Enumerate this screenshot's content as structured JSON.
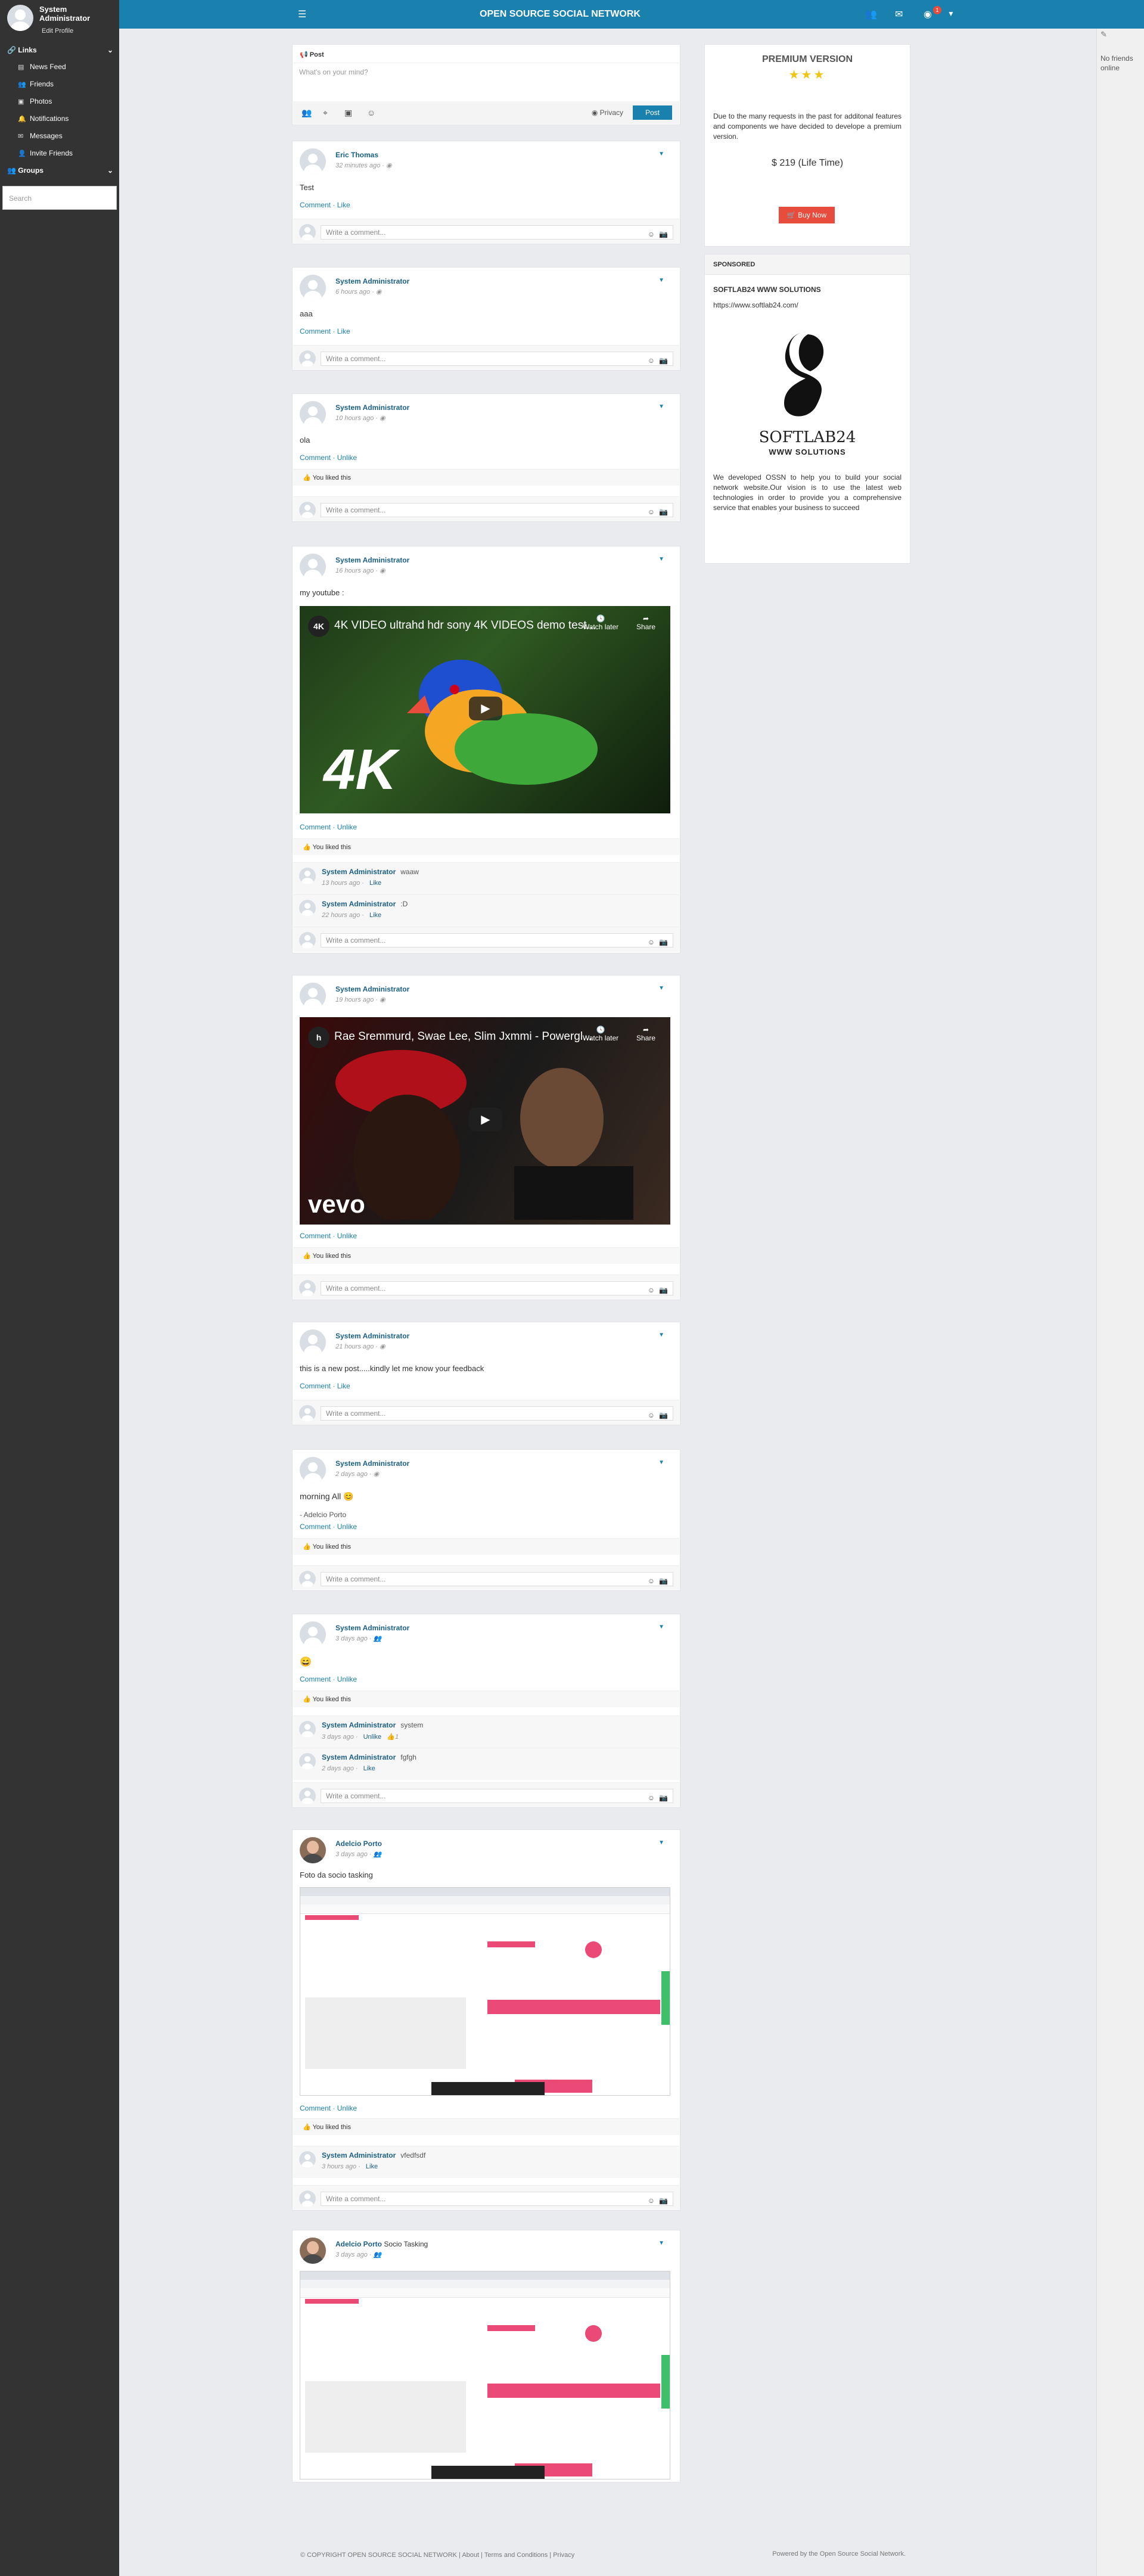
{
  "sidebar": {
    "profile_name": "System Administrator",
    "edit_profile": "Edit Profile",
    "links_label": "Links",
    "items": [
      {
        "label": "News Feed",
        "icon": "newspaper-icon"
      },
      {
        "label": "Friends",
        "icon": "users-icon"
      },
      {
        "label": "Photos",
        "icon": "image-icon"
      },
      {
        "label": "Notifications",
        "icon": "bell-icon"
      },
      {
        "label": "Messages",
        "icon": "envelope-icon"
      },
      {
        "label": "Invite Friends",
        "icon": "user-plus-icon"
      }
    ],
    "groups_label": "Groups",
    "search_placeholder": "Search"
  },
  "topbar": {
    "title": "OPEN SOURCE SOCIAL NETWORK",
    "notification_count": "1",
    "color": "#1a80ad"
  },
  "right_sidebar": {
    "status": "No friends online"
  },
  "post_composer": {
    "tab_label": "Post",
    "placeholder": "What's on your mind?",
    "privacy_label": "Privacy",
    "post_button": "Post"
  },
  "posts": [
    {
      "author": "Eric Thomas",
      "time": "32 minutes ago",
      "text": "Test",
      "actions": [
        "Comment",
        "Like"
      ]
    },
    {
      "author": "System Administrator",
      "time": "6 hours ago",
      "text": "aaa",
      "actions": [
        "Comment",
        "Like"
      ]
    },
    {
      "author": "System Administrator",
      "time": "10 hours ago",
      "text": "ola",
      "actions": [
        "Comment",
        "Unlike"
      ],
      "liked": "You liked this"
    },
    {
      "author": "System Administrator",
      "time": "16 hours ago",
      "text": "my youtube :",
      "video_title": "4K VIDEO ultrahd hdr sony 4K VIDEOS demo test...",
      "video_brand": "4K",
      "actions": [
        "Comment",
        "Unlike"
      ],
      "liked": "You liked this",
      "comments": [
        {
          "author": "System Administrator",
          "text": "waaw",
          "time": "13 hours ago",
          "action": "Like"
        },
        {
          "author": "System Administrator",
          "text": ":D",
          "time": "22 hours ago",
          "action": "Like"
        }
      ]
    },
    {
      "author": "System Administrator",
      "time": "19 hours ago",
      "text": "",
      "video_title": "Rae Sremmurd, Swae Lee, Slim Jxmmi - Powergl...",
      "video_brand": "vevo",
      "actions": [
        "Comment",
        "Unlike"
      ],
      "liked": "You liked this"
    },
    {
      "author": "System Administrator",
      "time": "21 hours ago",
      "text": "this is a new post.....kindly let me know your feedback",
      "actions": [
        "Comment",
        "Like"
      ]
    },
    {
      "author": "System Administrator",
      "time": "2 days ago",
      "text": "morning All 😊",
      "subtext": "- Adelcio Porto",
      "actions": [
        "Comment",
        "Unlike"
      ],
      "liked": "You liked this"
    },
    {
      "author": "System Administrator",
      "time": "3 days ago",
      "text": "😄",
      "actions": [
        "Comment",
        "Unlike"
      ],
      "liked": "You liked this",
      "comments": [
        {
          "author": "System Administrator",
          "text": "system",
          "time": "3 days ago",
          "action": "Unlike",
          "likes": "1"
        },
        {
          "author": "System Administrator",
          "text": "fgfgh",
          "time": "2 days ago",
          "action": "Like"
        }
      ]
    },
    {
      "author": "Adelcio Porto",
      "time": "3 days ago",
      "text": "Foto da socio tasking",
      "actions": [
        "Comment",
        "Unlike"
      ],
      "liked": "You liked this",
      "comments": [
        {
          "author": "System Administrator",
          "text": "vfedfsdf",
          "time": "3 hours ago",
          "action": "Like"
        }
      ]
    },
    {
      "author": "Adelcio Porto",
      "extra": "Socio Tasking",
      "time": "3 days ago",
      "text": ""
    }
  ],
  "comment_placeholder": "Write a comment...",
  "premium": {
    "title": "PREMIUM VERSION",
    "stars": "★★★",
    "description": "Due to the many requests in the past for additonal features and components we have decided to develope a premium version.",
    "price": "$ 219 (Life Time)",
    "buy_label": "Buy Now"
  },
  "sponsored": {
    "header": "SPONSORED",
    "name": "SOFTLAB24 WWW SOLUTIONS",
    "url": "https://www.softlab24.com/",
    "brand": "SOFTLAB24",
    "brand_sub": "WWW SOLUTIONS",
    "description": "We developed OSSN to help you to build your social network website.Our vision is to use the latest web technologies in order to provide you a comprehensive service that enables your business to succeed"
  },
  "footer": {
    "left": "© COPYRIGHT OPEN SOURCE SOCIAL NETWORK  |  About  |  Terms and Conditions  |  Privacy",
    "right": "Powered by the Open Source Social Network."
  }
}
